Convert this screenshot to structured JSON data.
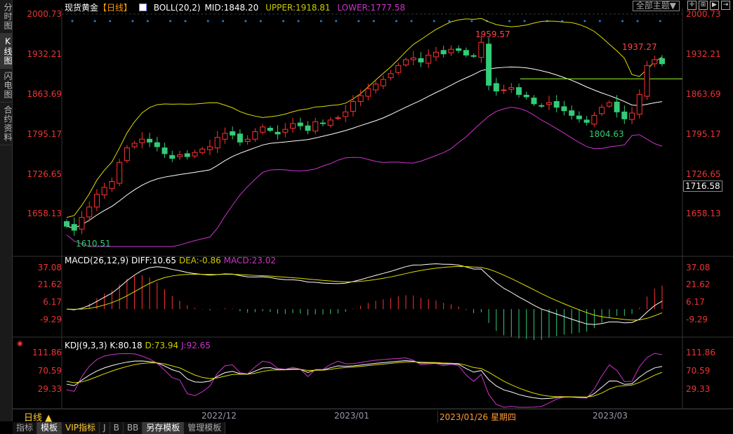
{
  "sidebar": [
    "分时图",
    "K线图",
    "闪电图",
    "合约资料"
  ],
  "header": {
    "title": "现货黄金",
    "period": "【日线】",
    "boll": "BOLL(20,2)",
    "mid": "MID:1848.20",
    "upper": "UPPER:1918.81",
    "lower": "LOWER:1777.58"
  },
  "toolbar": {
    "theme": "全部主题▼",
    "icons": [
      "crosshair-icon",
      "zoom-in-icon",
      "play-icon",
      "move-right-icon"
    ]
  },
  "price_axis": [
    "2000.73",
    "1932.21",
    "1863.69",
    "1795.17",
    "1726.65",
    "1658.13"
  ],
  "last_price": "1716.58",
  "markers": {
    "high": "1959.57",
    "low": "1610.51",
    "recent_high": "1937.27",
    "recent_low": "1804.63"
  },
  "macd": {
    "title": "MACD(26,12,9)",
    "diff": "DIFF:10.65",
    "dea": "DEA:-0.86",
    "macd": "MACD:23.02",
    "axis": [
      "37.08",
      "21.62",
      "6.17",
      "-9.29"
    ]
  },
  "kdj": {
    "title": "KDJ(9,3,3)",
    "k": "K:80.18",
    "d": "D:73.94",
    "j": "J:92.65",
    "axis": [
      "111.86",
      "70.59",
      "29.33"
    ]
  },
  "xaxis": {
    "period_btn": "日线 ▲",
    "labels": [
      "2022/12",
      "2023/01",
      "2023/03"
    ],
    "cursor": "2023/01/26 星期四"
  },
  "tabs": [
    "指标",
    "模板",
    "VIP指标",
    "J",
    "B",
    "BB",
    "另存模板",
    "管理模板"
  ],
  "colors": {
    "up": "#ff3333",
    "down": "#33cc77",
    "mid": "#ffffff",
    "upper": "#dddd00",
    "lower": "#cc33cc"
  },
  "chart_data": {
    "type": "candlestick",
    "level_line": 1889,
    "closes": [
      1635,
      1628,
      1650,
      1668,
      1690,
      1702,
      1712,
      1745,
      1770,
      1778,
      1785,
      1780,
      1772,
      1760,
      1752,
      1758,
      1755,
      1762,
      1768,
      1772,
      1788,
      1795,
      1792,
      1780,
      1785,
      1798,
      1806,
      1800,
      1794,
      1802,
      1812,
      1808,
      1800,
      1815,
      1812,
      1818,
      1822,
      1832,
      1850,
      1860,
      1872,
      1880,
      1888,
      1898,
      1912,
      1922,
      1925,
      1918,
      1930,
      1935,
      1932,
      1940,
      1938,
      1930,
      1928,
      1952,
      1878,
      1868,
      1870,
      1874,
      1862,
      1858,
      1846,
      1842,
      1848,
      1840,
      1834,
      1826,
      1820,
      1814,
      1826,
      1840,
      1848,
      1832,
      1820,
      1830,
      1862,
      1912,
      1922,
      1915
    ]
  }
}
